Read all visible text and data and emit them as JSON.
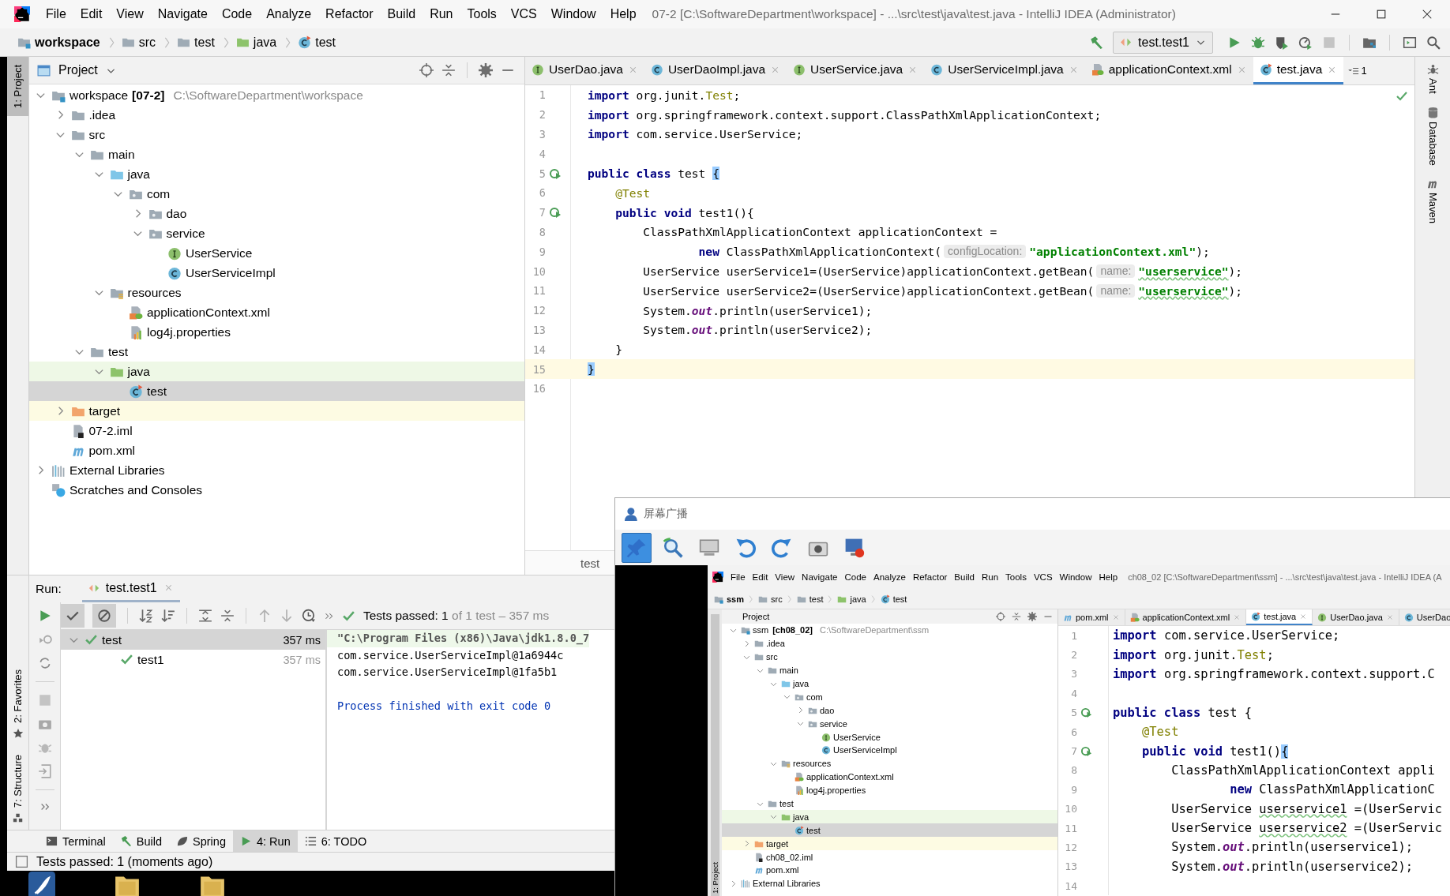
{
  "window": {
    "title": "07-2 [C:\\SoftwareDepartment\\workspace] - ...\\src\\test\\java\\test.java - IntelliJ IDEA (Administrator)"
  },
  "menu": [
    "File",
    "Edit",
    "View",
    "Navigate",
    "Code",
    "Analyze",
    "Refactor",
    "Build",
    "Run",
    "Tools",
    "VCS",
    "Window",
    "Help"
  ],
  "breadcrumb": [
    {
      "label": "workspace",
      "kind": "module"
    },
    {
      "label": "src",
      "kind": "folder"
    },
    {
      "label": "test",
      "kind": "folder"
    },
    {
      "label": "java",
      "kind": "test-folder"
    },
    {
      "label": "test",
      "kind": "test-class"
    }
  ],
  "run_config": "test.test1",
  "left_tools": [
    {
      "label": "1: Project",
      "selected": true
    }
  ],
  "project": {
    "title": "Project",
    "tree": [
      {
        "label": "workspace",
        "tag": "[07-2]",
        "note": "C:\\SoftwareDepartment\\workspace",
        "kind": "module",
        "expanded": true,
        "selected": false,
        "children": [
          {
            "label": ".idea",
            "kind": "folder",
            "expanded": false,
            "selected": false
          },
          {
            "label": "src",
            "kind": "folder",
            "expanded": true,
            "selected": false,
            "children": [
              {
                "label": "main",
                "kind": "folder",
                "expanded": true,
                "selected": false,
                "children": [
                  {
                    "label": "java",
                    "kind": "src-folder",
                    "expanded": true,
                    "selected": false,
                    "children": [
                      {
                        "label": "com",
                        "kind": "package",
                        "expanded": true,
                        "selected": false,
                        "children": [
                          {
                            "label": "dao",
                            "kind": "package",
                            "expanded": false,
                            "selected": false
                          },
                          {
                            "label": "service",
                            "kind": "package",
                            "expanded": true,
                            "selected": false,
                            "children": [
                              {
                                "label": "UserService",
                                "kind": "interface",
                                "selected": false
                              },
                              {
                                "label": "UserServiceImpl",
                                "kind": "class",
                                "selected": false
                              }
                            ]
                          }
                        ]
                      }
                    ]
                  },
                  {
                    "label": "resources",
                    "kind": "resources",
                    "expanded": true,
                    "selected": false,
                    "children": [
                      {
                        "label": "applicationContext.xml",
                        "kind": "xml",
                        "selected": false
                      },
                      {
                        "label": "log4j.properties",
                        "kind": "properties",
                        "selected": false
                      }
                    ]
                  }
                ]
              },
              {
                "label": "test",
                "kind": "folder",
                "expanded": true,
                "selected": false,
                "children": [
                  {
                    "label": "java",
                    "kind": "test-folder",
                    "expanded": true,
                    "selected": false,
                    "color": "#eef8e6",
                    "children": [
                      {
                        "label": "test",
                        "kind": "test-class",
                        "selected": true
                      }
                    ]
                  }
                ]
              }
            ]
          },
          {
            "label": "target",
            "kind": "excluded-folder",
            "expanded": false,
            "selected": false,
            "color": "#fdfbe3"
          },
          {
            "label": "07-2.iml",
            "kind": "iml",
            "selected": false
          },
          {
            "label": "pom.xml",
            "kind": "maven",
            "selected": false
          }
        ]
      },
      {
        "label": "External Libraries",
        "kind": "libs",
        "expanded": false,
        "selected": false
      },
      {
        "label": "Scratches and Consoles",
        "kind": "scratch",
        "selected": false
      }
    ]
  },
  "editor_tabs": [
    {
      "label": "UserDao.java",
      "kind": "interface",
      "selected": false
    },
    {
      "label": "UserDaoImpl.java",
      "kind": "class",
      "selected": false
    },
    {
      "label": "UserService.java",
      "kind": "interface",
      "selected": false
    },
    {
      "label": "UserServiceImpl.java",
      "kind": "class",
      "selected": false
    },
    {
      "label": "applicationContext.xml",
      "kind": "xml",
      "selected": false
    },
    {
      "label": "test.java",
      "kind": "test-class",
      "selected": true
    }
  ],
  "hidden_tabs": "1",
  "code": [
    {
      "n": "1",
      "selected": false,
      "tokens": [
        {
          "text": "import",
          "kind": "kw"
        },
        {
          "text": " org.junit."
        },
        {
          "text": "Test",
          "kind": "type"
        },
        {
          "text": ";"
        }
      ]
    },
    {
      "n": "2",
      "selected": false,
      "tokens": [
        {
          "text": "import",
          "kind": "kw"
        },
        {
          "text": " org.springframework.context.support.ClassPathXmlApplicationContext;"
        }
      ]
    },
    {
      "n": "3",
      "selected": false,
      "tokens": [
        {
          "text": "import",
          "kind": "kw"
        },
        {
          "text": " com.service.UserService;"
        }
      ]
    },
    {
      "n": "4",
      "selected": false
    },
    {
      "n": "5",
      "selected": false,
      "test_marker": true,
      "tokens": [
        {
          "text": "public class",
          "kind": "kw"
        },
        {
          "text": " test "
        },
        {
          "text": "{",
          "kind": "match"
        }
      ]
    },
    {
      "n": "6",
      "selected": false,
      "tokens": [
        {
          "text": "    @Test",
          "kind": "ann"
        }
      ]
    },
    {
      "n": "7",
      "selected": false,
      "test_marker": true,
      "tokens": [
        {
          "text": "    public void",
          "kind": "kw"
        },
        {
          "text": " test1(){"
        }
      ]
    },
    {
      "n": "8",
      "selected": false,
      "tokens": [
        {
          "text": "        ClassPathXmlApplicationContext applicationContext ="
        }
      ]
    },
    {
      "n": "9",
      "selected": false,
      "tokens": [
        {
          "text": "                new",
          "kind": "kw"
        },
        {
          "text": " ClassPathXmlApplicationContext("
        },
        {
          "text": "configLocation:",
          "kind": "hint"
        },
        {
          "text": "\"applicationContext.xml\"",
          "kind": "str"
        },
        {
          "text": ");"
        }
      ]
    },
    {
      "n": "10",
      "selected": false,
      "tokens": [
        {
          "text": "        UserService userService1=(UserService)applicationContext.getBean("
        },
        {
          "text": "name:",
          "kind": "hint"
        },
        {
          "text": "\"userservice\"",
          "kind": "typo"
        },
        {
          "text": ");"
        }
      ]
    },
    {
      "n": "11",
      "selected": false,
      "tokens": [
        {
          "text": "        UserService userService2=(UserService)applicationContext.getBean("
        },
        {
          "text": "name:",
          "kind": "hint"
        },
        {
          "text": "\"userservice\"",
          "kind": "typo"
        },
        {
          "text": ");"
        }
      ]
    },
    {
      "n": "12",
      "selected": false,
      "tokens": [
        {
          "text": "        System."
        },
        {
          "text": "out",
          "kind": "field"
        },
        {
          "text": ".println(userService1);"
        }
      ]
    },
    {
      "n": "13",
      "selected": false,
      "tokens": [
        {
          "text": "        System."
        },
        {
          "text": "out",
          "kind": "field"
        },
        {
          "text": ".println(userService2);"
        }
      ]
    },
    {
      "n": "14",
      "selected": false,
      "tokens": [
        {
          "text": "    }"
        }
      ]
    },
    {
      "n": "15",
      "selected": true,
      "tokens": [
        {
          "text": "}",
          "kind": "match"
        }
      ]
    },
    {
      "n": "16",
      "selected": false
    }
  ],
  "editor_breadcrumb": "test",
  "right_tools": [
    "Ant",
    "Database",
    "Maven"
  ],
  "run": {
    "label": "Run:",
    "tab": "test.test1",
    "toggles": [
      {
        "kind": "passed",
        "on": true
      },
      {
        "kind": "ignored",
        "on": true
      }
    ],
    "summary": "Tests passed: 1",
    "summary_detail": "of 1 test – 357 ms",
    "tests": [
      {
        "label": "test",
        "time": "357 ms",
        "selected": true,
        "expanded": true,
        "children": [
          {
            "label": "test1",
            "time": "357 ms",
            "selected": false
          }
        ]
      }
    ],
    "console": [
      {
        "text": "\"C:\\Program Files (x86)\\Java\\jdk1.8.0_7",
        "kind": "command"
      },
      {
        "text": "com.service.UserServiceImpl@1a6944c",
        "kind": "out"
      },
      {
        "text": "com.service.UserServiceImpl@1fa5b1",
        "kind": "out"
      },
      {
        "text": "Process finished with exit code 0",
        "kind": "system"
      }
    ]
  },
  "run_side_tools": [
    {
      "label": "2: Favorites",
      "kind": "star"
    },
    {
      "label": "7: Structure",
      "kind": "structure"
    }
  ],
  "bottom_tabs": [
    {
      "label": "Terminal",
      "kind": "terminal",
      "selected": false
    },
    {
      "label": "Build",
      "kind": "hammer",
      "selected": false
    },
    {
      "label": "Spring",
      "kind": "leaf",
      "selected": false
    },
    {
      "label": "4: Run",
      "kind": "run",
      "selected": true
    },
    {
      "label": "6: TODO",
      "kind": "list",
      "selected": false
    }
  ],
  "status": "Tests passed: 1 (moments ago)",
  "cast": {
    "title": "屏幕广播",
    "tools": [
      {
        "kind": "pin",
        "on": true
      },
      {
        "kind": "zoom",
        "on": false
      },
      {
        "kind": "monitor",
        "on": false
      },
      {
        "kind": "undo",
        "on": false
      },
      {
        "kind": "redo",
        "on": false
      },
      {
        "kind": "camera",
        "on": false
      },
      {
        "kind": "record",
        "on": false
      }
    ],
    "ide": {
      "menu": [
        "File",
        "Edit",
        "View",
        "Navigate",
        "Code",
        "Analyze",
        "Refactor",
        "Build",
        "Run",
        "Tools",
        "VCS",
        "Window",
        "Help"
      ],
      "title": "ch08_02 [C:\\SoftwareDepartment\\ssm] - ...\\src\\test\\java\\test.java - IntelliJ IDEA (A",
      "breadcrumb": [
        {
          "label": "ssm",
          "kind": "module"
        },
        {
          "label": "src",
          "kind": "folder"
        },
        {
          "label": "test",
          "kind": "folder"
        },
        {
          "label": "java",
          "kind": "test-folder"
        },
        {
          "label": "test",
          "kind": "test-class"
        }
      ],
      "left_tool": "1: Project",
      "project_title": "Project",
      "tree": [
        {
          "label": "ssm",
          "tag": "[ch08_02]",
          "note": "C:\\SoftwareDepartment\\ssm",
          "kind": "module",
          "expanded": true,
          "selected": false,
          "children": [
            {
              "label": ".idea",
              "kind": "folder",
              "expanded": false,
              "selected": false
            },
            {
              "label": "src",
              "kind": "folder",
              "expanded": true,
              "selected": false,
              "children": [
                {
                  "label": "main",
                  "kind": "folder",
                  "expanded": true,
                  "selected": false,
                  "children": [
                    {
                      "label": "java",
                      "kind": "src-folder",
                      "expanded": true,
                      "selected": false,
                      "children": [
                        {
                          "label": "com",
                          "kind": "package",
                          "expanded": true,
                          "selected": false,
                          "children": [
                            {
                              "label": "dao",
                              "kind": "package",
                              "expanded": false,
                              "selected": false
                            },
                            {
                              "label": "service",
                              "kind": "package",
                              "expanded": true,
                              "selected": false,
                              "children": [
                                {
                                  "label": "UserService",
                                  "kind": "interface",
                                  "selected": false
                                },
                                {
                                  "label": "UserServiceImpl",
                                  "kind": "class",
                                  "selected": false
                                }
                              ]
                            }
                          ]
                        }
                      ]
                    },
                    {
                      "label": "resources",
                      "kind": "resources",
                      "expanded": true,
                      "selected": false,
                      "children": [
                        {
                          "label": "applicationContext.xml",
                          "kind": "xml",
                          "selected": false
                        },
                        {
                          "label": "log4j.properties",
                          "kind": "properties",
                          "selected": false
                        }
                      ]
                    }
                  ]
                },
                {
                  "label": "test",
                  "kind": "folder",
                  "expanded": true,
                  "selected": false,
                  "children": [
                    {
                      "label": "java",
                      "kind": "test-folder",
                      "expanded": true,
                      "selected": false,
                      "color": "#eef8e6",
                      "children": [
                        {
                          "label": "test",
                          "kind": "test-class",
                          "selected": true
                        }
                      ]
                    }
                  ]
                }
              ]
            },
            {
              "label": "target",
              "kind": "excluded-folder",
              "expanded": false,
              "selected": false,
              "color": "#fdfbe3"
            },
            {
              "label": "ch08_02.iml",
              "kind": "iml",
              "selected": false
            },
            {
              "label": "pom.xml",
              "kind": "maven",
              "selected": false
            }
          ]
        },
        {
          "label": "External Libraries",
          "kind": "libs",
          "expanded": false,
          "selected": false
        }
      ],
      "tabs": [
        {
          "label": "pom.xml",
          "kind": "maven",
          "selected": false
        },
        {
          "label": "applicationContext.xml",
          "kind": "xml",
          "selected": false
        },
        {
          "label": "test.java",
          "kind": "test-class",
          "selected": true
        },
        {
          "label": "UserDao.java",
          "kind": "interface",
          "selected": false
        },
        {
          "label": "UserDao",
          "kind": "class",
          "selected": false
        }
      ],
      "code": [
        {
          "n": "1",
          "tokens": [
            {
              "text": "import",
              "kind": "kw"
            },
            {
              "text": " com.service.UserService;"
            }
          ]
        },
        {
          "n": "2",
          "tokens": [
            {
              "text": "import",
              "kind": "kw"
            },
            {
              "text": " org.junit."
            },
            {
              "text": "Test",
              "kind": "type"
            },
            {
              "text": ";"
            }
          ]
        },
        {
          "n": "3",
          "tokens": [
            {
              "text": "import",
              "kind": "kw"
            },
            {
              "text": " org.springframework.context.support.C"
            }
          ]
        },
        {
          "n": "4"
        },
        {
          "n": "5",
          "test_marker": true,
          "tokens": [
            {
              "text": "public class",
              "kind": "kw"
            },
            {
              "text": " test {"
            }
          ]
        },
        {
          "n": "6",
          "tokens": [
            {
              "text": "    @Test",
              "kind": "ann"
            }
          ]
        },
        {
          "n": "7",
          "test_marker": true,
          "tokens": [
            {
              "text": "    public void",
              "kind": "kw"
            },
            {
              "text": " test1()"
            },
            {
              "text": "{",
              "kind": "match"
            }
          ]
        },
        {
          "n": "8",
          "tokens": [
            {
              "text": "        ClassPathXmlApplicationContext appli"
            }
          ]
        },
        {
          "n": "9",
          "tokens": [
            {
              "text": "                new",
              "kind": "kw"
            },
            {
              "text": " ClassPathXmlApplicationC"
            }
          ]
        },
        {
          "n": "10",
          "tokens": [
            {
              "text": "        UserService "
            },
            {
              "text": "userservice1",
              "kind": "typo-plain"
            },
            {
              "text": " =(UserServic"
            }
          ]
        },
        {
          "n": "11",
          "tokens": [
            {
              "text": "        UserService "
            },
            {
              "text": "userservice2",
              "kind": "typo-plain"
            },
            {
              "text": " =(UserServic"
            }
          ]
        },
        {
          "n": "12",
          "tokens": [
            {
              "text": "        System."
            },
            {
              "text": "out",
              "kind": "field"
            },
            {
              "text": ".println(userservice1);"
            }
          ]
        },
        {
          "n": "13",
          "tokens": [
            {
              "text": "        System."
            },
            {
              "text": "out",
              "kind": "field"
            },
            {
              "text": ".println(userservice2);"
            }
          ]
        },
        {
          "n": "14"
        }
      ]
    }
  }
}
